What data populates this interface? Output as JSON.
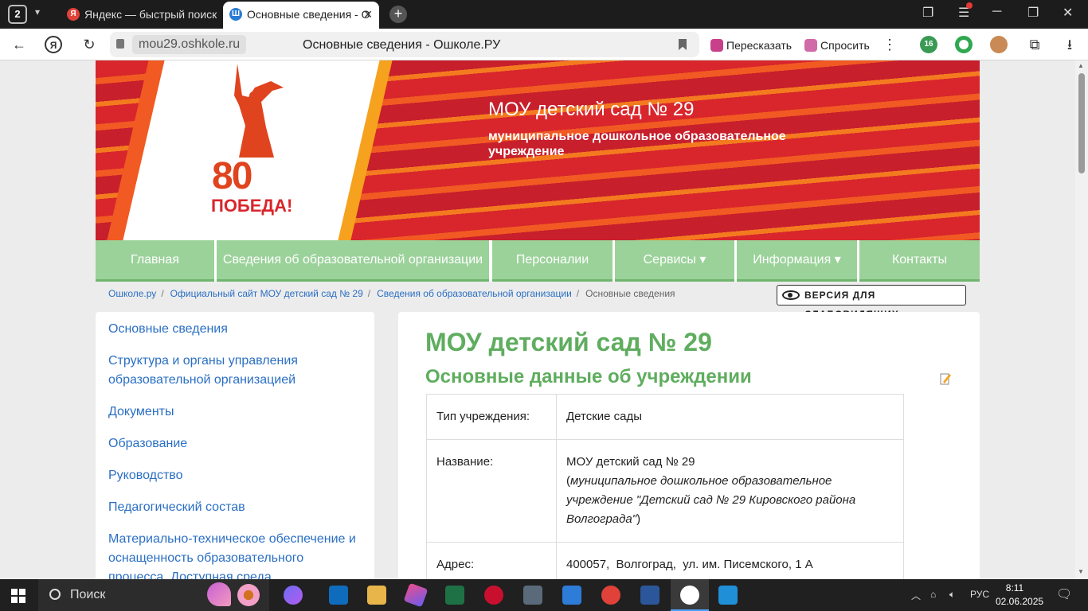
{
  "browser": {
    "tab_count": "2",
    "tabs": [
      {
        "title": "Яндекс — быстрый поиск",
        "favicon": "Я"
      },
      {
        "title": "Основные сведения - О",
        "favicon": "Ш"
      }
    ],
    "url_domain": "mou29.oshkole.ru",
    "page_title": "Основные сведения - Ошколе.РУ",
    "retell_label": "Пересказать",
    "ask_label": "Спросить",
    "ext_badge": "16"
  },
  "banner": {
    "title": "МОУ детский сад № 29",
    "subtitle": "муниципальное дошкольное образовательное учреждение",
    "logo_number": "80",
    "logo_word": "ПОБЕДА!"
  },
  "menu": [
    {
      "label": "Главная"
    },
    {
      "label": "Сведения об образовательной организации"
    },
    {
      "label": "Персоналии"
    },
    {
      "label": "Сервисы ▾"
    },
    {
      "label": "Информация ▾"
    },
    {
      "label": "Контакты"
    }
  ],
  "breadcrumbs": [
    {
      "label": "Ошколе.ру"
    },
    {
      "label": "Официальный сайт МОУ детский сад № 29"
    },
    {
      "label": "Сведения об образовательной организации"
    },
    {
      "label": "Основные сведения"
    }
  ],
  "low_vision_label": "ВЕРСИЯ ДЛЯ СЛАБОВИДЯЩИХ",
  "sidebar": [
    {
      "label": "Основные сведения"
    },
    {
      "label": "Структура и органы управления образовательной организацией"
    },
    {
      "label": "Документы"
    },
    {
      "label": "Образование"
    },
    {
      "label": "Руководство"
    },
    {
      "label": "Педагогический состав"
    },
    {
      "label": "Материально-техническое обеспечение и оснащенность образовательного процесса. Доступная среда"
    }
  ],
  "content": {
    "heading": "МОУ детский сад № 29",
    "subheading": "Основные данные об учреждении",
    "rows": [
      {
        "key": "Тип учреждения:",
        "value": "Детские сады"
      },
      {
        "key": "Название:",
        "value": "МОУ детский сад № 29",
        "value_extra_open": "(",
        "value_extra": "муниципальное дошкольное образовательное учреждение \"Детский сад № 29 Кировского района Волгограда\"",
        "value_extra_close": ")"
      },
      {
        "key": "Адрес:",
        "value": "400057,  Волгоград,  ул. им. Писемского, 1 А"
      }
    ]
  },
  "taskbar": {
    "search_label": "Поиск",
    "lang": "РУС",
    "time": "8:11",
    "date": "02.06.2025"
  }
}
